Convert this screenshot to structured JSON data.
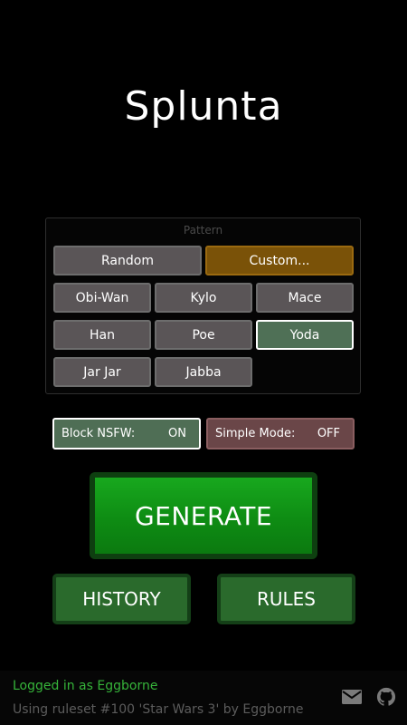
{
  "app": {
    "title": "Splunta"
  },
  "pattern": {
    "label": "Pattern",
    "options": [
      {
        "label": "Random"
      },
      {
        "label": "Custom..."
      },
      {
        "label": "Obi-Wan"
      },
      {
        "label": "Kylo"
      },
      {
        "label": "Mace"
      },
      {
        "label": "Han"
      },
      {
        "label": "Poe"
      },
      {
        "label": "Yoda"
      },
      {
        "label": "Jar Jar"
      },
      {
        "label": "Jabba"
      }
    ],
    "selected": "Yoda"
  },
  "toggles": {
    "nsfw": {
      "label": "Block NSFW:",
      "value": "ON"
    },
    "simple": {
      "label": "Simple Mode:",
      "value": "OFF"
    }
  },
  "actions": {
    "generate": "GENERATE",
    "history": "HISTORY",
    "rules": "RULES"
  },
  "footer": {
    "login_text": "Logged in as Eggborne",
    "ruleset_text": "Using ruleset #100 'Star Wars 3' by Eggborne",
    "icons": [
      "mail-icon",
      "github-icon"
    ]
  },
  "colors": {
    "background": "#000000",
    "button_default": "#5a5557",
    "button_custom": "#7a5208",
    "button_selected": "#4f7056",
    "toggle_on": "#4f6e55",
    "toggle_off": "#6a4648",
    "generate": "#11991a",
    "secondary": "#2a6a2c",
    "login_text": "#36b43a",
    "ruleset_text": "#5c5c5c"
  }
}
